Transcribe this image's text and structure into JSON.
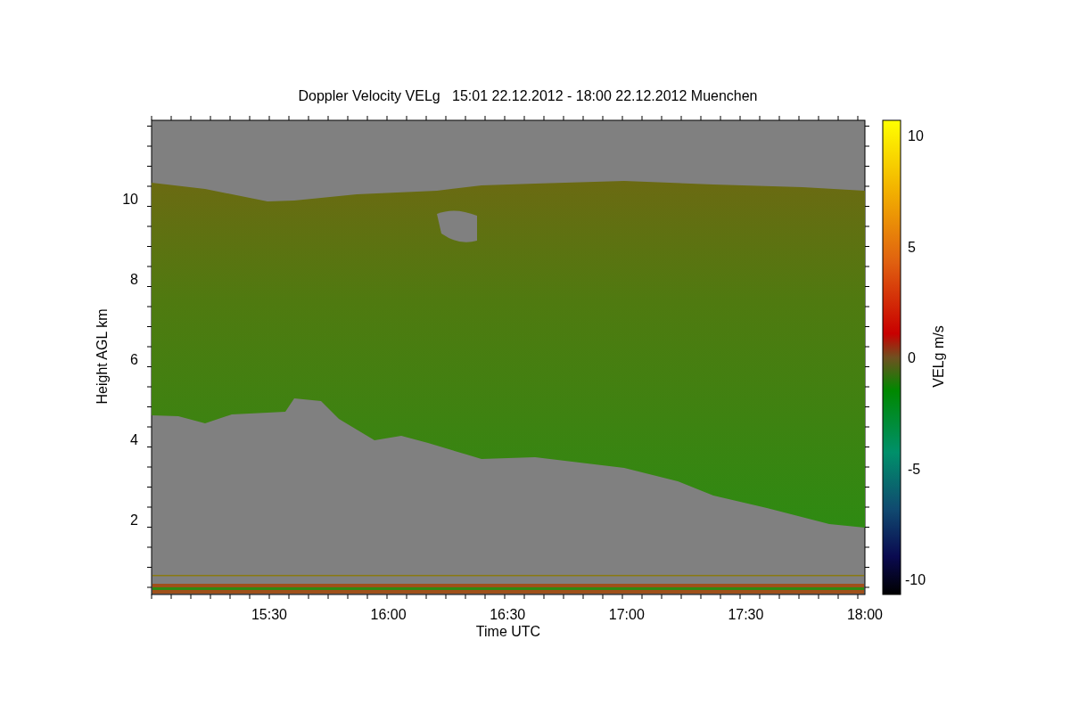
{
  "title": "Doppler Velocity VELg   15:01 22.12.2012 - 18:00 22.12.2012 Muenchen",
  "y_axis": {
    "label": "Height AGL km",
    "ticks": [
      "10",
      "8",
      "6",
      "4",
      "2"
    ]
  },
  "x_axis": {
    "label": "Time UTC",
    "ticks": [
      "15:30",
      "16:00",
      "16:30",
      "17:00",
      "17:30",
      "18:00"
    ]
  },
  "colorbar": {
    "label": "VELg m/s",
    "ticks": [
      "10",
      "5",
      "0",
      "-5",
      "-10"
    ]
  }
}
